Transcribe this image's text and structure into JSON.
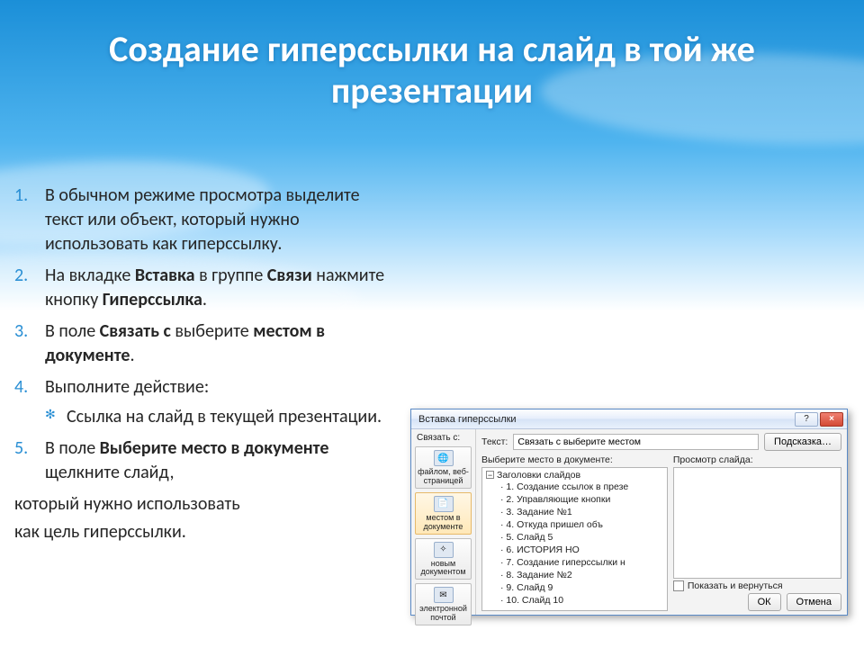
{
  "title": "Создание гиперссылки на слайд в той же презентации",
  "steps": {
    "s1": {
      "text": "В обычном режиме просмотра выделите текст или объект, который нужно использовать как гиперссылку."
    },
    "s2": {
      "pre": "На вкладке ",
      "b1": "Вставка",
      "mid1": " в группе ",
      "b2": "Связи",
      "mid2": " нажмите кнопку ",
      "b3": "Гиперссылка",
      "post": "."
    },
    "s3": {
      "pre": "В поле ",
      "b1": "Связать с",
      "mid": " выберите ",
      "b2": "местом в документе",
      "post": "."
    },
    "s4": {
      "text": "Выполните действие:",
      "bullet": "Ссылка на слайд в текущей презентации."
    },
    "s5": {
      "pre": "В поле ",
      "b1": "Выберите место в документе",
      "post": " щелкните слайд,"
    }
  },
  "tail1": "который нужно использовать",
  "tail2": "как цель гиперссылки.",
  "dialog": {
    "title": "Вставка гиперссылки",
    "help_icon": "?",
    "close_icon": "×",
    "link_with_label": "Связать с:",
    "text_label": "Текст:",
    "text_value": "Связать с выберите местом",
    "hint_btn": "Подсказка…",
    "side": {
      "web": "файлом, веб-страницей",
      "doc": "местом в документе",
      "new": "новым документом",
      "mail": "электронной почтой"
    },
    "place_label": "Выберите место в документе:",
    "preview_label": "Просмотр слайда:",
    "tree_root": "Заголовки слайдов",
    "tree_items": [
      "1. Создание ссылок в презе",
      "2. Управляющие кнопки",
      "3. Задание №1",
      "4. Откуда пришел        объ",
      "5. Слайд 5",
      "6.        ИСТОРИЯ      НО",
      "7. Создание гиперссылки н",
      "8. Задание №2",
      "9. Слайд 9",
      "10. Слайд 10"
    ],
    "show_return": "Показать и вернуться",
    "ok": "ОК",
    "cancel": "Отмена"
  }
}
